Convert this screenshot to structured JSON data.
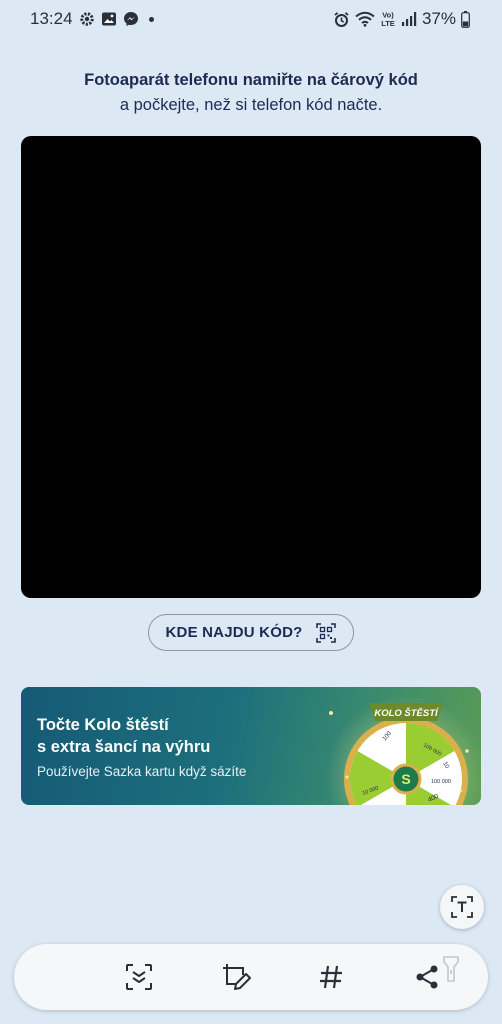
{
  "status_bar": {
    "time": "13:24",
    "left_icons": [
      "gear-icon",
      "gallery-icon",
      "messenger-icon",
      "notification-dot"
    ],
    "right_icons": [
      "alarm-icon",
      "wifi-icon",
      "volte-icon",
      "signal-icon",
      "battery-icon"
    ],
    "volte_label": "VoLTE",
    "battery_percent": "37%"
  },
  "instructions": {
    "line1": "Fotoaparát telefonu namiřte na čárový kód",
    "line2": "a počkejte, než si telefon kód načte."
  },
  "where_button": {
    "label": "KDE NAJDU KÓD?",
    "icon": "qr-code-icon"
  },
  "banner": {
    "title_line1": "Točte Kolo štěstí",
    "title_line2": "s extra šancí na výhru",
    "subtitle": "Používejte Sazka kartu když sázíte",
    "wheel_label": "KOLO ŠTĚSTÍ",
    "wheel_segments": [
      "100 000",
      "10",
      "100 000",
      "400",
      "10 000",
      "100"
    ],
    "colors": {
      "wheel_green": "#9acd32",
      "wheel_gold": "#d9b04a"
    }
  },
  "text_fab": {
    "icon": "text-scan-icon"
  },
  "toolbar": {
    "icons": [
      "scan-icon",
      "edit-crop-icon",
      "hashtag-icon",
      "share-icon",
      "flashlight-icon"
    ]
  },
  "colors": {
    "background": "#dce9f5",
    "text_primary": "#1d2a52",
    "camera": "#000000"
  }
}
